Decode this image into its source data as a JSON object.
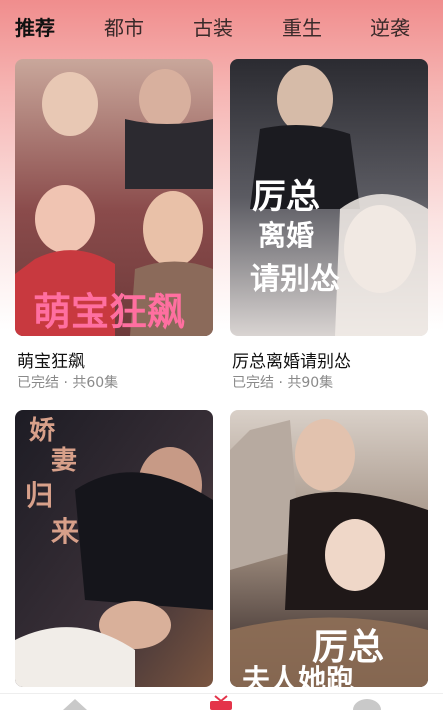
{
  "tabs": [
    {
      "label": "推荐",
      "active": true
    },
    {
      "label": "都市",
      "active": false
    },
    {
      "label": "古装",
      "active": false
    },
    {
      "label": "重生",
      "active": false
    },
    {
      "label": "逆袭",
      "active": false
    }
  ],
  "dramas": [
    {
      "title": "萌宝狂飙",
      "status": "已完结 · 共60集",
      "poster_text": "萌宝狂飙",
      "poster_colors": [
        "#c9a79b",
        "#6d3a3a",
        "#e85a8a"
      ]
    },
    {
      "title": "厉总离婚请别怂",
      "status": "已完结 · 共90集",
      "poster_text_lines": [
        "厉总",
        "离婚",
        "请别怂"
      ],
      "poster_colors": [
        "#2b2b31",
        "#7a7a80",
        "#d9d4d2"
      ]
    },
    {
      "title": "",
      "status": "",
      "poster_text_lines": [
        "娇",
        "妻",
        "归",
        "来"
      ],
      "poster_colors": [
        "#1d1c24",
        "#7a5540",
        "#c79a86"
      ]
    },
    {
      "title": "",
      "status": "",
      "poster_text_lines": [
        "厉总",
        "夫人她跑"
      ],
      "poster_colors": [
        "#d9d0c8",
        "#2a1e1e",
        "#8f6f56"
      ]
    }
  ],
  "accent_color": "#e4344a"
}
